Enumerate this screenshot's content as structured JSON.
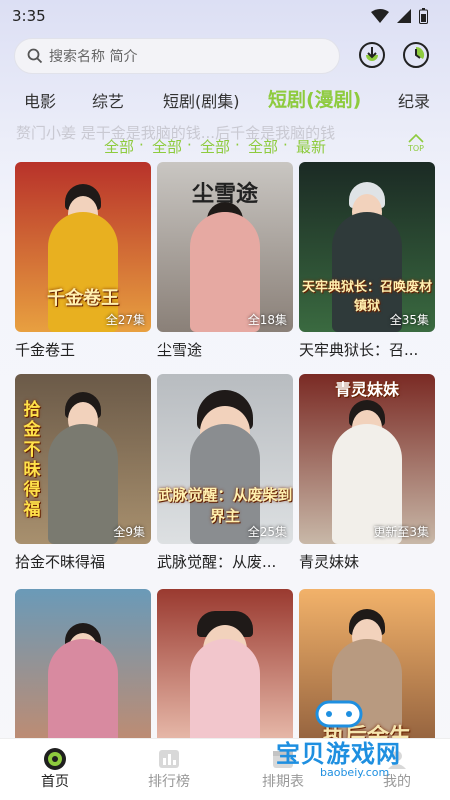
{
  "status": {
    "time": "3:35"
  },
  "search": {
    "placeholder": "搜索名称 简介"
  },
  "tabs": [
    {
      "label": "电影"
    },
    {
      "label": "综艺"
    },
    {
      "label": "短剧(剧集)"
    },
    {
      "label": "短剧(漫剧)",
      "active": true
    },
    {
      "label": "纪录"
    }
  ],
  "ghost_text": "赘门小姜    是干金是我脑的钱...后千金是我脑的钱",
  "filters": [
    "全部",
    "全部",
    "全部",
    "全部",
    "最新"
  ],
  "top_button": {
    "label": "TOP"
  },
  "cards": [
    {
      "title": "千金卷王",
      "badge": "全27集",
      "poster_text": "千金卷王",
      "bg": "#b8322a",
      "bg2": "#e8a040",
      "figure": "#e8b020"
    },
    {
      "title": "尘雪途",
      "badge": "全18集",
      "poster_text": "尘雪途",
      "bg": "#c9c6c2",
      "bg2": "#8a8078",
      "figure": "#e6a9a2"
    },
    {
      "title": "天牢典狱长：召...",
      "badge": "全35集",
      "poster_text": "天牢典狱长：召唤废材镇狱",
      "bg": "#1b2a24",
      "bg2": "#3a6a40",
      "figure": "#2f3a3a"
    },
    {
      "title": "拾金不昧得福",
      "badge": "全9集",
      "poster_text": "拾金不昧得福",
      "bg": "#6b5a48",
      "bg2": "#a8906e",
      "figure": "#7a7a70"
    },
    {
      "title": "武脉觉醒：从废...",
      "badge": "全25集",
      "poster_text": "武脉觉醒：从废柴到界主",
      "bg": "#b8bcc0",
      "bg2": "#dde0e2",
      "figure": "#8a8d90"
    },
    {
      "title": "青灵妹妹",
      "badge": "更新至3集",
      "poster_text": "青灵妹妹",
      "bg": "#7a2a24",
      "bg2": "#c8b8a8",
      "figure": "#f2efea"
    },
    {
      "title": "",
      "badge": "",
      "poster_text": "",
      "bg": "#6a9ab8",
      "bg2": "#c88a6a",
      "figure": "#d88aa0"
    },
    {
      "title": "",
      "badge": "",
      "poster_text": "",
      "bg": "#9a3a30",
      "bg2": "#f0c8b8",
      "figure": "#f2c6cc"
    },
    {
      "title": "",
      "badge": "",
      "poster_text": "执后余生",
      "bg": "#f2b26a",
      "bg2": "#8a5a3a",
      "figure": "#b89a80"
    }
  ],
  "bottom_nav": [
    {
      "label": "首页",
      "active": true
    },
    {
      "label": "排行榜"
    },
    {
      "label": "排期表"
    },
    {
      "label": "我的"
    }
  ],
  "watermark": {
    "text": "宝贝游戏网",
    "url": "baobeiy.com"
  },
  "colors": {
    "accent": "#8ecb3e",
    "watermark": "#1e8fe0"
  }
}
